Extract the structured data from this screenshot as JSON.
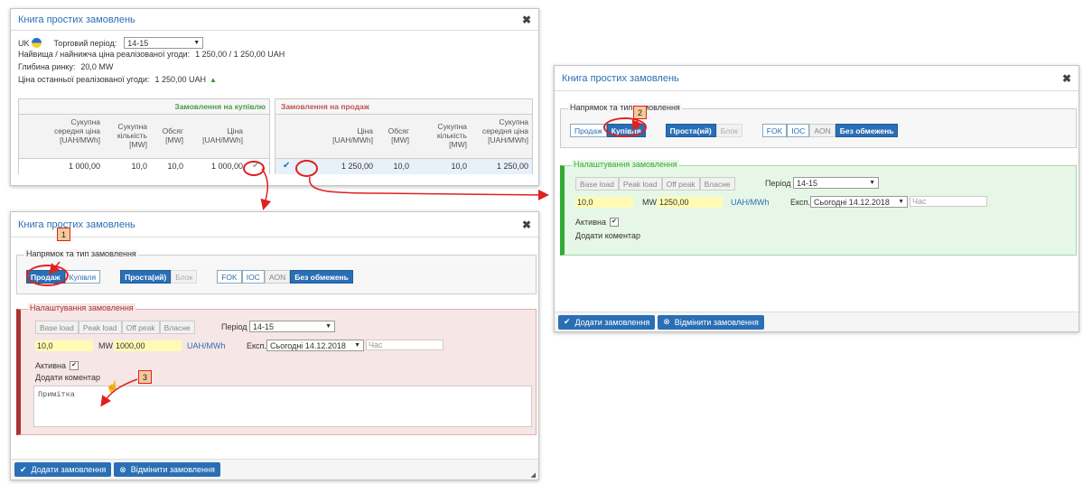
{
  "book_window": {
    "title": "Книга простих замовлень",
    "country_code": "UK",
    "period_label": "Торговий період:",
    "period_value": "14-15",
    "high_low_label": "Найвища / найнижча ціна реалізованої угоди:",
    "high_low_value": "1 250,00 / 1 250,00 UAH",
    "depth_label": "Глибина ринку:",
    "depth_value": "20,0 MW",
    "last_price_label": "Ціна останньої реалізованої угоди:",
    "last_price_value": "1 250,00 UAH",
    "buy_header": "Замовлення на купівлю",
    "sell_header": "Замовлення на продаж",
    "buy_cols": [
      "Сукупна середня ціна [UAH/MWh]",
      "Сукупна кількість [MW]",
      "Обсяг [MW]",
      "Ціна [UAH/MWh]"
    ],
    "sell_cols": [
      "Ціна [UAH/MWh]",
      "Обсяг [MW]",
      "Сукупна кількість [MW]",
      "Сукупна середня ціна [UAH/MWh]"
    ],
    "buy_row": [
      "1 000,00",
      "10,0",
      "10,0",
      "1 000,00"
    ],
    "sell_row": [
      "1 250,00",
      "10,0",
      "10,0",
      "1 250,00"
    ]
  },
  "order_form_sell": {
    "title": "Книга простих замовлень",
    "direction_legend": "Напрямок та тип замовлення",
    "btn_sell": "Продаж",
    "btn_buy": "Купівля",
    "btn_simple": "Проста(ий)",
    "btn_block": "Блок",
    "btn_fok": "FOK",
    "btn_ioc": "IOC",
    "btn_aon": "AON",
    "btn_nolimit": "Без обмежень",
    "settings_legend": "Налаштування замовлення",
    "btn_base": "Base load",
    "btn_peak": "Peak load",
    "btn_offpeak": "Off peak",
    "btn_own": "Власне",
    "period_label": "Період",
    "period_value": "14-15",
    "qty": "10,0",
    "qty_unit": "MW",
    "price": "1000,00",
    "price_unit": "UAH/MWh",
    "exp_label": "Експ.",
    "exp_value": "Сьогодні 14.12.2018",
    "time_placeholder": "Час",
    "active_label": "Активна",
    "comment_label": "Додати коментар",
    "note_placeholder": "Примітка",
    "add_btn": "Додати замовлення",
    "cancel_btn": "Відмінити замовлення"
  },
  "order_form_buy": {
    "title": "Книга простих замовлень",
    "direction_legend": "Напрямок та тип замовлення",
    "btn_sell": "Продаж",
    "btn_buy": "Купівля",
    "btn_simple": "Проста(ий)",
    "btn_block": "Блок",
    "btn_fok": "FOK",
    "btn_ioc": "IOC",
    "btn_aon": "AON",
    "btn_nolimit": "Без обмежень",
    "settings_legend": "Налаштування замовлення",
    "btn_base": "Base load",
    "btn_peak": "Peak load",
    "btn_offpeak": "Off peak",
    "btn_own": "Власне",
    "period_label": "Період",
    "period_value": "14-15",
    "qty": "10,0",
    "qty_unit": "MW",
    "price": "1250,00",
    "price_unit": "UAH/MWh",
    "exp_label": "Експ.",
    "exp_value": "Сьогодні 14.12.2018",
    "time_placeholder": "Час",
    "active_label": "Активна",
    "comment_label": "Додати коментар",
    "add_btn": "Додати замовлення",
    "cancel_btn": "Відмінити замовлення"
  },
  "annotations": {
    "b1": "1",
    "b2": "2",
    "b3": "3"
  },
  "colors": {
    "accent": "#2a6fb5",
    "annotation": "#e02020",
    "sell_panel": "#f7e6e6",
    "buy_panel": "#e7f7e7"
  }
}
